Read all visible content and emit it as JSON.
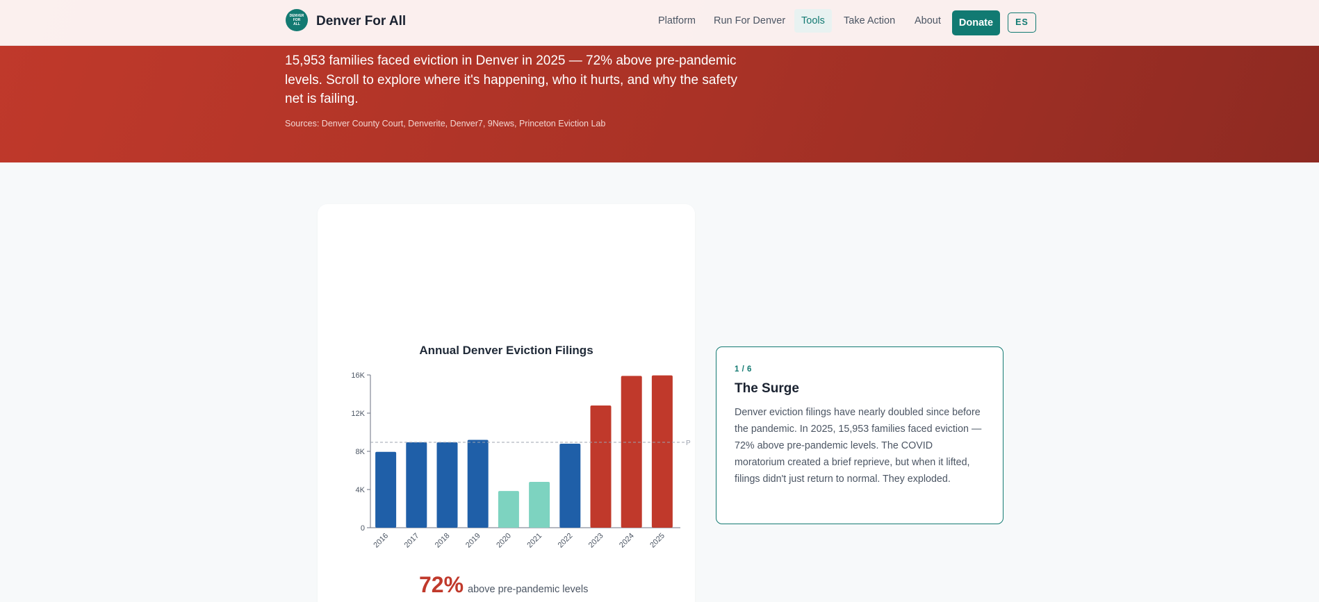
{
  "nav": {
    "brand": "Denver For All",
    "logo_text": [
      "DENVER",
      "FOR",
      "ALL"
    ],
    "links": [
      "Platform",
      "Run For Denver",
      "Tools",
      "Take Action",
      "About"
    ],
    "active_link": "Tools",
    "donate": "Donate",
    "lang": "ES"
  },
  "hero": {
    "text": "15,953 families faced eviction in Denver in 2025 — 72% above pre-pandemic levels. Scroll to explore where it's happening, who it hurts, and why the safety net is failing.",
    "sources": "Sources: Denver County Court, Denverite, Denver7, 9News, Princeton Eviction Lab"
  },
  "chart_data": {
    "type": "bar",
    "title": "Annual Denver Eviction Filings",
    "categories": [
      "2016",
      "2017",
      "2018",
      "2019",
      "2020",
      "2021",
      "2022",
      "2023",
      "2024",
      "2025"
    ],
    "values": [
      7950,
      8950,
      8950,
      9200,
      3850,
      4800,
      8800,
      12800,
      15900,
      15953
    ],
    "bar_colors": [
      "#1f5fa8",
      "#1f5fa8",
      "#1f5fa8",
      "#1f5fa8",
      "#7dd3c0",
      "#7dd3c0",
      "#1f5fa8",
      "#c0392b",
      "#c0392b",
      "#c0392b"
    ],
    "ylim": [
      0,
      16000
    ],
    "yticks": [
      0,
      4000,
      8000,
      12000,
      16000
    ],
    "ytick_labels": [
      "0",
      "4K",
      "8K",
      "12K",
      "16K"
    ],
    "reference_line": {
      "value": 8950,
      "label": "P"
    },
    "grid": false,
    "xlabel": "",
    "ylabel": ""
  },
  "stat": {
    "value": "72%",
    "label": "above pre-pandemic levels"
  },
  "step": {
    "count": "1 / 6",
    "title": "The Surge",
    "body": "Denver eviction filings have nearly doubled since before the pandemic. In 2025, 15,953 families faced eviction — 72% above pre-pandemic levels. The COVID moratorium created a brief reprieve, but when it lifted, filings didn't just return to normal. They exploded."
  }
}
